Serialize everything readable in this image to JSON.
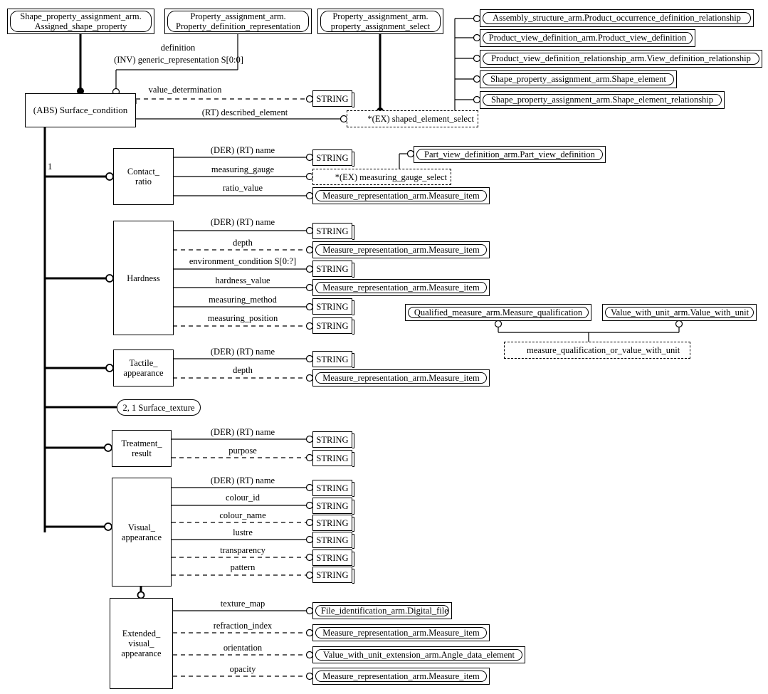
{
  "diagram": {
    "type": "EXPRESS-G entity-level diagram",
    "root_entity": "(ABS) Surface_condition"
  },
  "top_refs": [
    {
      "id": "ref_assigned_shape_property",
      "label_line1": "Shape_property_assignment_arm.",
      "label_line2": "Assigned_shape_property"
    },
    {
      "id": "ref_property_definition_representation",
      "label_line1": "Property_assignment_arm.",
      "label_line2": "Property_definition_representation"
    },
    {
      "id": "ref_property_assignment_select",
      "label_line1": "Property_assignment_arm.",
      "label_line2": "property_assignment_select"
    }
  ],
  "right_refs": [
    {
      "id": "ref_product_occurrence_definition_relationship",
      "label": "Assembly_structure_arm.Product_occurrence_definition_relationship"
    },
    {
      "id": "ref_product_view_definition",
      "label": "Product_view_definition_arm.Product_view_definition"
    },
    {
      "id": "ref_view_definition_relationship",
      "label": "Product_view_definition_relationship_arm.View_definition_relationship"
    },
    {
      "id": "ref_shape_element",
      "label": "Shape_property_assignment_arm.Shape_element"
    },
    {
      "id": "ref_shape_element_relationship",
      "label": "Shape_property_assignment_arm.Shape_element_relationship"
    }
  ],
  "root": {
    "label": "(ABS) Surface_condition",
    "incoming": {
      "definition_label": "definition",
      "generic_representation_label": "(INV) generic_representation S[0:0]"
    },
    "attributes": [
      {
        "name": "value_determination",
        "optional": true,
        "target": "STRING"
      },
      {
        "name": "(RT) described_element",
        "optional": false,
        "target": "*(EX) shaped_element_select"
      }
    ],
    "supertype_index": "1"
  },
  "selects": {
    "shaped_element_select": "*(EX) shaped_element_select",
    "measuring_gauge_select": "*(EX) measuring_gauge_select",
    "measure_qualification_or_value_with_unit": "measure_qualification_or_value_with_unit"
  },
  "subtypes": [
    {
      "id": "contact_ratio",
      "name_line1": "Contact_",
      "name_line2": "ratio",
      "attributes": [
        {
          "name": "(DER) (RT) name",
          "optional": false,
          "target_kind": "simpletype",
          "target": "STRING"
        },
        {
          "name": "measuring_gauge",
          "optional": false,
          "target_kind": "selectbox",
          "target": "*(EX) measuring_gauge_select"
        },
        {
          "name": "ratio_value",
          "optional": false,
          "target_kind": "schemaref",
          "target": "Measure_representation_arm.Measure_item"
        }
      ]
    },
    {
      "id": "hardness",
      "name_line1": "Hardness",
      "name_line2": "",
      "attributes": [
        {
          "name": "(DER) (RT) name",
          "optional": false,
          "target_kind": "simpletype",
          "target": "STRING"
        },
        {
          "name": "depth",
          "optional": true,
          "target_kind": "schemaref",
          "target": "Measure_representation_arm.Measure_item"
        },
        {
          "name": "environment_condition S[0:?]",
          "optional": false,
          "target_kind": "simpletype",
          "target": "STRING"
        },
        {
          "name": "hardness_value",
          "optional": false,
          "target_kind": "schemaref",
          "target": "Measure_representation_arm.Measure_item"
        },
        {
          "name": "measuring_method",
          "optional": false,
          "target_kind": "simpletype",
          "target": "STRING"
        },
        {
          "name": "measuring_position",
          "optional": true,
          "target_kind": "simpletype",
          "target": "STRING"
        }
      ]
    },
    {
      "id": "tactile_appearance",
      "name_line1": "Tactile_",
      "name_line2": "appearance",
      "attributes": [
        {
          "name": "(DER) (RT) name",
          "optional": false,
          "target_kind": "simpletype",
          "target": "STRING"
        },
        {
          "name": "depth",
          "optional": true,
          "target_kind": "schemaref",
          "target": "Measure_representation_arm.Measure_item"
        }
      ]
    },
    {
      "id": "surface_texture",
      "name_line1": "2, 1 Surface_texture",
      "name_line2": "",
      "attributes": []
    },
    {
      "id": "treatment_result",
      "name_line1": "Treatment_",
      "name_line2": "result",
      "attributes": [
        {
          "name": "(DER) (RT) name",
          "optional": false,
          "target_kind": "simpletype",
          "target": "STRING"
        },
        {
          "name": "purpose",
          "optional": true,
          "target_kind": "simpletype",
          "target": "STRING"
        }
      ]
    },
    {
      "id": "visual_appearance",
      "name_line1": "Visual_",
      "name_line2": "appearance",
      "attributes": [
        {
          "name": "(DER) (RT) name",
          "optional": false,
          "target_kind": "simpletype",
          "target": "STRING"
        },
        {
          "name": "colour_id",
          "optional": false,
          "target_kind": "simpletype",
          "target": "STRING"
        },
        {
          "name": "colour_name",
          "optional": true,
          "target_kind": "simpletype",
          "target": "STRING"
        },
        {
          "name": "lustre",
          "optional": false,
          "target_kind": "simpletype",
          "target": "STRING"
        },
        {
          "name": "transparency",
          "optional": true,
          "target_kind": "simpletype",
          "target": "STRING"
        },
        {
          "name": "pattern",
          "optional": true,
          "target_kind": "simpletype",
          "target": "STRING"
        }
      ]
    },
    {
      "id": "extended_visual_appearance",
      "name_line1": "Extended_",
      "name_line2": "visual_",
      "name_line3": "appearance",
      "attributes": [
        {
          "name": "texture_map",
          "optional": false,
          "target_kind": "schemaref",
          "target": "File_identification_arm.Digital_file"
        },
        {
          "name": "refraction_index",
          "optional": true,
          "target_kind": "schemaref",
          "target": "Measure_representation_arm.Measure_item"
        },
        {
          "name": "orientation",
          "optional": true,
          "target_kind": "schemaref",
          "target": "Value_with_unit_extension_arm.Angle_data_element"
        },
        {
          "name": "opacity",
          "optional": true,
          "target_kind": "schemaref",
          "target": "Measure_representation_arm.Measure_item"
        }
      ]
    }
  ],
  "side_refs": {
    "part_view_definition": "Part_view_definition_arm.Part_view_definition",
    "measure_qualification": "Qualified_measure_arm.Measure_qualification",
    "value_with_unit": "Value_with_unit_arm.Value_with_unit"
  },
  "nodes": {
    "string": "STRING",
    "measure_item": "Measure_representation_arm.Measure_item"
  },
  "colors": {
    "stroke": "#000000",
    "background": "#ffffff"
  }
}
